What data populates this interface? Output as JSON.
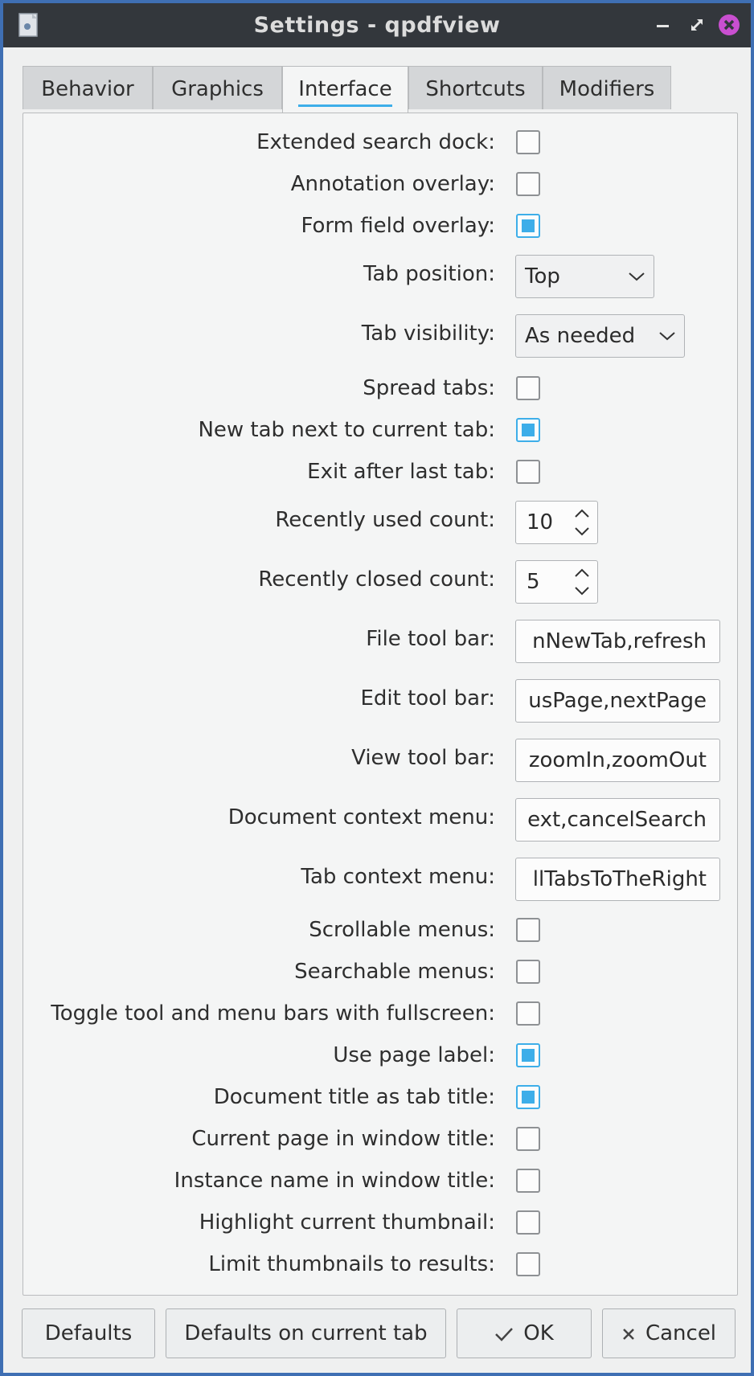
{
  "window": {
    "title": "Settings - qpdfview",
    "colors": {
      "titlebar": "#33373c",
      "accent": "#3daee9",
      "close": "#c94fd0",
      "border": "#3f6fb3"
    }
  },
  "tabs": [
    {
      "label": "Behavior",
      "active": false
    },
    {
      "label": "Graphics",
      "active": false
    },
    {
      "label": "Interface",
      "active": true
    },
    {
      "label": "Shortcuts",
      "active": false
    },
    {
      "label": "Modifiers",
      "active": false
    }
  ],
  "settings": {
    "extended_search_dock": {
      "label": "Extended search dock:",
      "checked": false
    },
    "annotation_overlay": {
      "label": "Annotation overlay:",
      "checked": false
    },
    "form_field_overlay": {
      "label": "Form field overlay:",
      "checked": true
    },
    "tab_position": {
      "label": "Tab position:",
      "value": "Top"
    },
    "tab_visibility": {
      "label": "Tab visibility:",
      "value": "As needed"
    },
    "spread_tabs": {
      "label": "Spread tabs:",
      "checked": false
    },
    "new_tab_next": {
      "label": "New tab next to current tab:",
      "checked": true
    },
    "exit_after_last_tab": {
      "label": "Exit after last tab:",
      "checked": false
    },
    "recently_used_count": {
      "label": "Recently used count:",
      "value": "10"
    },
    "recently_closed_count": {
      "label": "Recently closed count:",
      "value": "5"
    },
    "file_tool_bar": {
      "label": "File tool bar:",
      "value": "nNewTab,refresh"
    },
    "edit_tool_bar": {
      "label": "Edit tool bar:",
      "value": "usPage,nextPage"
    },
    "view_tool_bar": {
      "label": "View tool bar:",
      "value": "zoomIn,zoomOut"
    },
    "document_context_menu": {
      "label": "Document context menu:",
      "value": "ext,cancelSearch"
    },
    "tab_context_menu": {
      "label": "Tab context menu:",
      "value": "llTabsToTheRight"
    },
    "scrollable_menus": {
      "label": "Scrollable menus:",
      "checked": false
    },
    "searchable_menus": {
      "label": "Searchable menus:",
      "checked": false
    },
    "toggle_bars_fullscreen": {
      "label": "Toggle tool and menu bars with fullscreen:",
      "checked": false
    },
    "use_page_label": {
      "label": "Use page label:",
      "checked": true
    },
    "document_title_as_tab_title": {
      "label": "Document title as tab title:",
      "checked": true
    },
    "current_page_in_window_title": {
      "label": "Current page in window title:",
      "checked": false
    },
    "instance_name_in_window_title": {
      "label": "Instance name in window title:",
      "checked": false
    },
    "highlight_current_thumbnail": {
      "label": "Highlight current thumbnail:",
      "checked": false
    },
    "limit_thumbnails_to_results": {
      "label": "Limit thumbnails to results:",
      "checked": false
    }
  },
  "buttons": {
    "defaults": "Defaults",
    "defaults_current_tab": "Defaults on current tab",
    "ok": "OK",
    "cancel": "Cancel"
  }
}
